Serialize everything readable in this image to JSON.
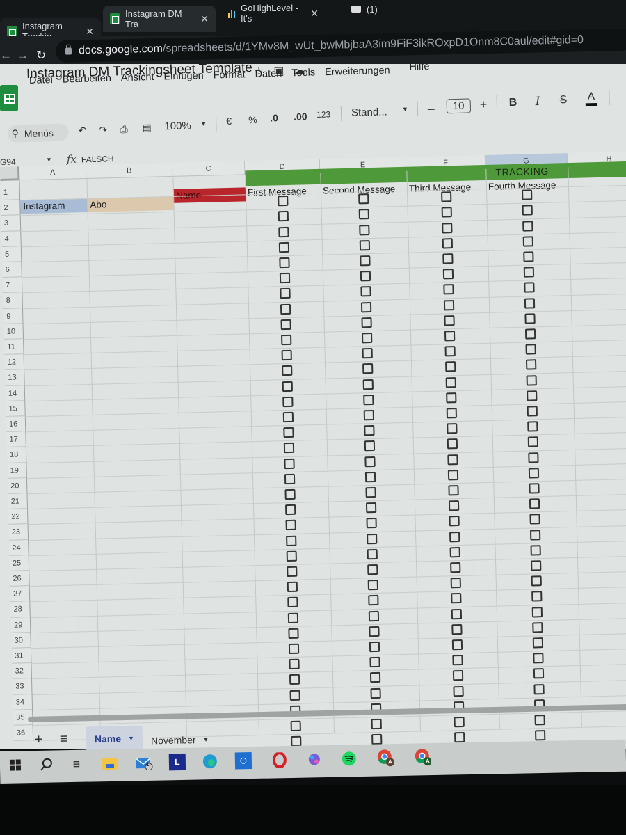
{
  "browser": {
    "tabs": [
      {
        "title": "Instagram Trackin",
        "icon": "sheets-icon",
        "active": false
      },
      {
        "title": "Instagram DM Tra",
        "icon": "sheets-icon",
        "active": true
      },
      {
        "title": "GoHighLevel - It's",
        "icon": "bar-chart-icon",
        "active": false
      },
      {
        "title": "(1)",
        "icon": "app-icon",
        "active": false
      }
    ],
    "close_glyph": "✕",
    "url_host": "docs.google.com",
    "url_path": "/spreadsheets/d/1YMv8M_wUt_bwMbjbaA3im9FiF3ikROxpD1Onm8C0aul/edit#gid=0"
  },
  "document": {
    "title": "Instagram DM Trackingsheet Template",
    "menu": [
      "Datei",
      "Bearbeiten",
      "Ansicht",
      "Einfügen",
      "Format",
      "Daten",
      "Tools",
      "Erweiterungen",
      "Hilfe"
    ]
  },
  "toolbar": {
    "search_label": "Menüs",
    "zoom": "100%",
    "currency": "€",
    "percent": "%",
    "decrease_decimals": ".0",
    "increase_decimals": ".00",
    "number_format": "123",
    "font": "Stand...",
    "font_size": "10",
    "minus": "–",
    "plus": "+",
    "bold": "B",
    "italic": "I",
    "strikethrough": "S",
    "text_color": "A"
  },
  "formula_bar": {
    "cell_ref": "G94",
    "fx": "fx",
    "value": "FALSCH"
  },
  "sheet": {
    "columns": [
      "A",
      "B",
      "C",
      "D",
      "E",
      "F",
      "G",
      "H"
    ],
    "selected_column": "G",
    "row_count_visible": 36,
    "header_row": {
      "tracking_label": "TRACKING",
      "A": "Instagram",
      "B": "Abo",
      "C": "Name",
      "D": "First Message",
      "E": "Second Message",
      "F": "Third Message",
      "G": "Fourth Message"
    },
    "header_colors": {
      "instagram": "#a9bcd6",
      "abo": "#dcc9ad",
      "name": "#b8262b",
      "tracking": "#4e9a3b"
    },
    "checkbox_columns": [
      "D",
      "E",
      "F",
      "G"
    ],
    "checkbox_state": "all unchecked"
  },
  "sheet_tabs": {
    "add": "+",
    "all_sheets": "≡",
    "tabs": [
      {
        "label": "Name",
        "active": true
      },
      {
        "label": "November",
        "active": false
      }
    ]
  },
  "taskbar": {
    "items": [
      "start",
      "search",
      "task-view",
      "file-explorer",
      "mail",
      "app-L",
      "edge",
      "app-blue",
      "opera",
      "copilot",
      "spotify",
      "chrome-profile-A",
      "chrome-profile-A-2"
    ],
    "mail_badge": "1",
    "L_label": "L",
    "profile_letter": "A"
  }
}
